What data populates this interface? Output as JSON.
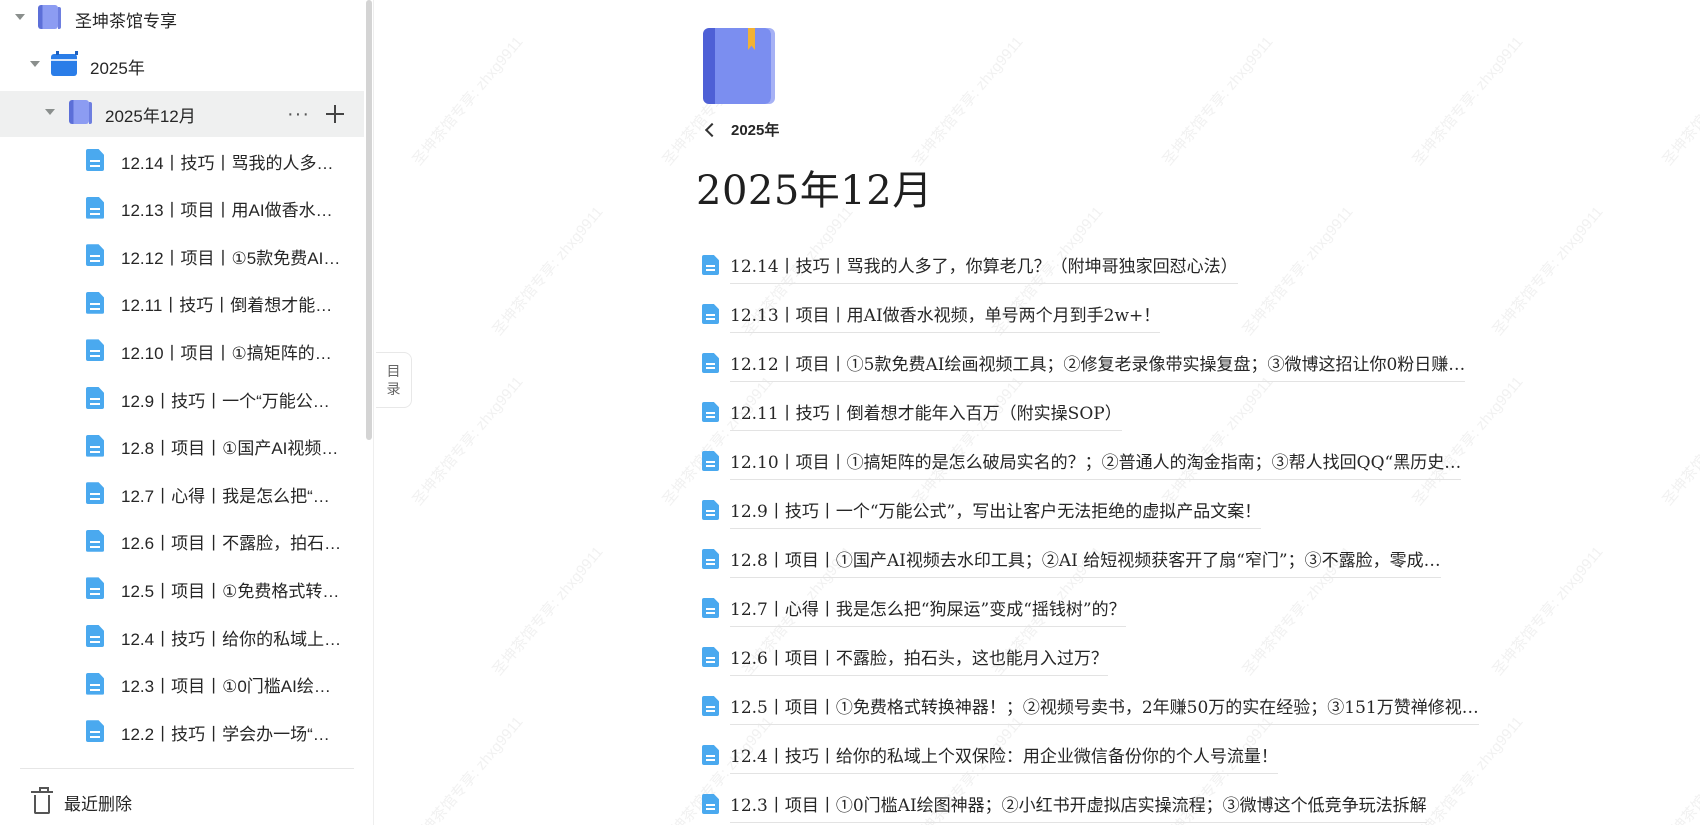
{
  "sidebar": {
    "root": {
      "label": "圣坤茶馆专享"
    },
    "year": {
      "label": "2025年"
    },
    "month": {
      "label": "2025年12月",
      "more_icon": "more-dots-icon",
      "add_icon": "plus-icon"
    },
    "docs": [
      {
        "label": "12.14丨技巧丨骂我的人多了，你算老几？（附坤哥独家回怼心法）"
      },
      {
        "label": "12.13丨项目丨用AI做香水视频，单号两个月到手2w+！"
      },
      {
        "label": "12.12丨项目丨①5款免费AI绘画视频工具"
      },
      {
        "label": "12.11丨技巧丨倒着想才能年入百万"
      },
      {
        "label": "12.10丨项目丨①搞矩阵的是怎么破局实名的？"
      },
      {
        "label": "12.9丨技巧丨一个“万能公式”，写出让客户无法拒绝的虚拟产品文案！"
      },
      {
        "label": "12.8丨项目丨①国产AI视频去水印工具"
      },
      {
        "label": "12.7丨心得丨我是怎么把“狗屎运”变成“摇钱树”的？"
      },
      {
        "label": "12.6丨项目丨不露脸，拍石头，这也能月入过万？"
      },
      {
        "label": "12.5丨项目丨①免费格式转换神器！"
      },
      {
        "label": "12.4丨技巧丨给你的私域上个双保险：用企业微信备份你的个人号流量！"
      },
      {
        "label": "12.3丨项目丨①0门槛AI绘图神器"
      },
      {
        "label": "12.2丨技巧丨学会办一场“…"
      }
    ],
    "trash": {
      "label": "最近删除"
    }
  },
  "toc_toggle": {
    "line1": "目",
    "line2": "录"
  },
  "main": {
    "breadcrumb": "2025年",
    "title": "2025年12月",
    "docs": [
      {
        "label": "12.14丨技巧丨骂我的人多了，你算老几？（附坤哥独家回怼心法）"
      },
      {
        "label": "12.13丨项目丨用AI做香水视频，单号两个月到手2w+！"
      },
      {
        "label": "12.12丨项目丨①5款免费AI绘画视频工具；②修复老录像带实操复盘；③微博这招让你0粉日赚…"
      },
      {
        "label": "12.11丨技巧丨倒着想才能年入百万（附实操SOP）"
      },
      {
        "label": "12.10丨项目丨①搞矩阵的是怎么破局实名的？；②普通人的淘金指南；③帮人找回QQ“黑历史…"
      },
      {
        "label": "12.9丨技巧丨一个“万能公式”，写出让客户无法拒绝的虚拟产品文案！"
      },
      {
        "label": "12.8丨项目丨①国产AI视频去水印工具；②AI 给短视频获客开了扇“窄门”；③不露脸，零成…"
      },
      {
        "label": "12.7丨心得丨我是怎么把“狗屎运”变成“摇钱树”的？"
      },
      {
        "label": "12.6丨项目丨不露脸，拍石头，这也能月入过万？"
      },
      {
        "label": "12.5丨项目丨①免费格式转换神器！；②视频号卖书，2年赚50万的实在经验；③151万赞禅修视…"
      },
      {
        "label": "12.4丨技巧丨给你的私域上个双保险：用企业微信备份你的个人号流量！"
      },
      {
        "label": "12.3丨项目丨①0门槛AI绘图神器；②小红书开虚拟店实操流程；③微博这个低竞争玩法拆解"
      }
    ]
  },
  "watermark": "圣坤茶馆专享: zhxg9911",
  "colors": {
    "accent": "#4aa9ef",
    "book": "#7b8ef0",
    "active_row": "#eff0f0"
  }
}
